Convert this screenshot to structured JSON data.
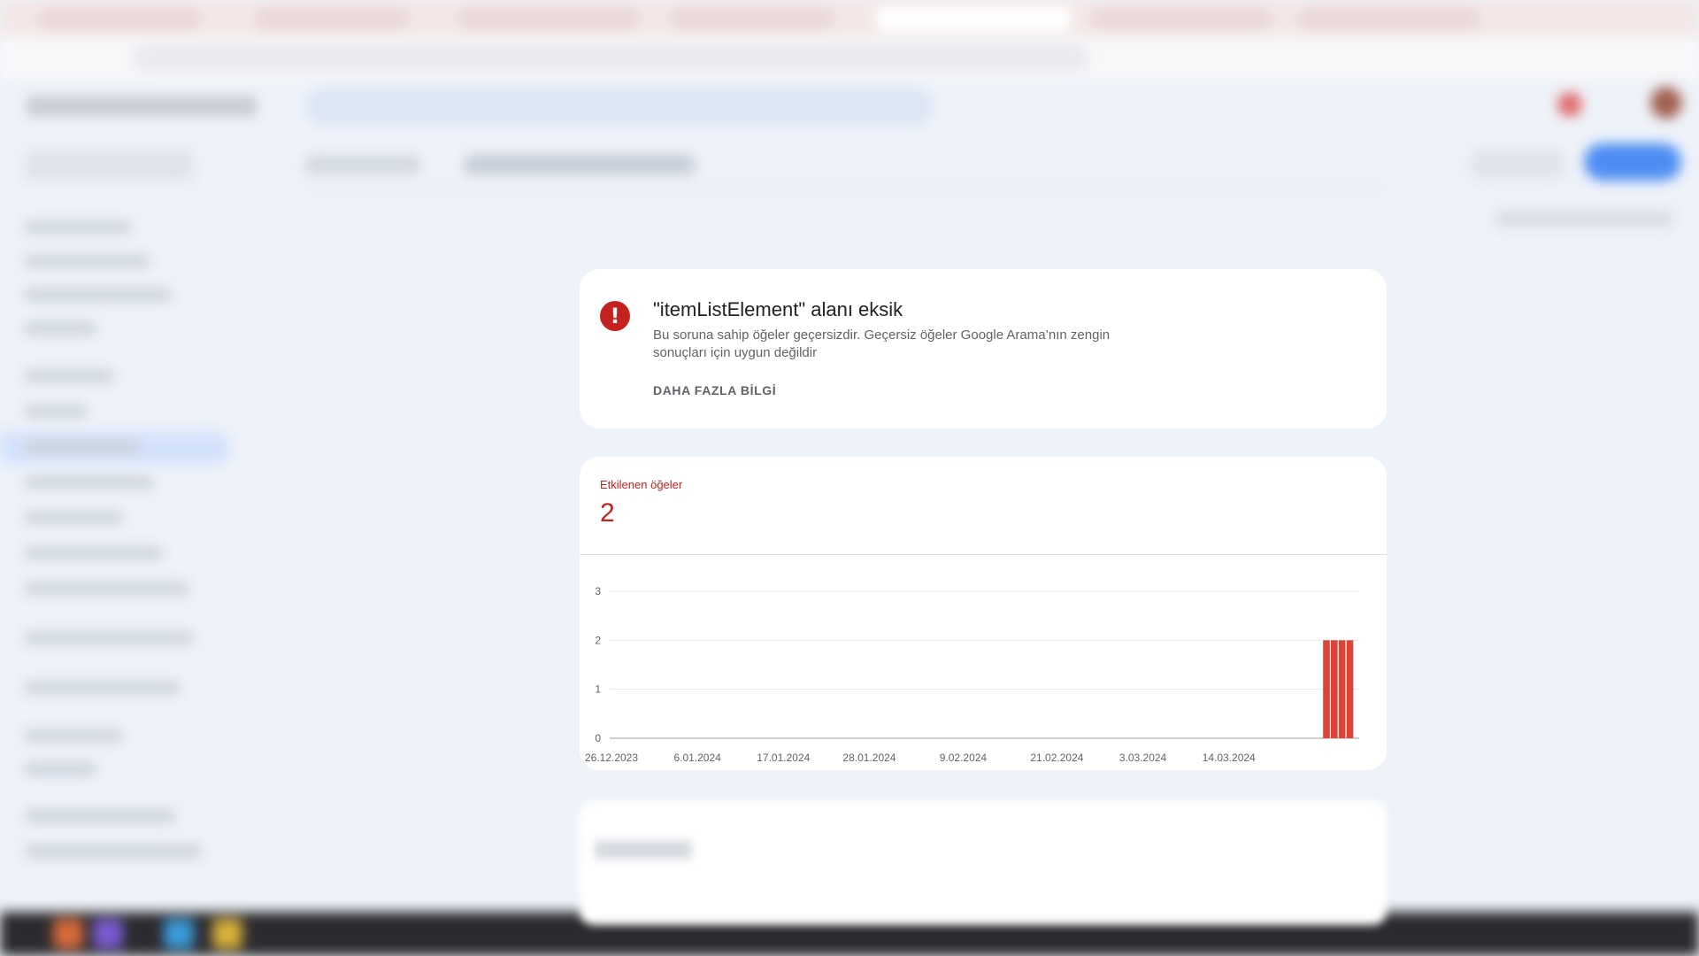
{
  "issue": {
    "title": "\"itemListElement\" alanı eksik",
    "description": "Bu soruna sahip öğeler geçersizdir. Geçersiz öğeler Google Arama’nın zengin sonuçları için uygun değildir",
    "learn_more": "DAHA FAZLA BİLGİ",
    "icon": "error-icon",
    "color": "#c5221f"
  },
  "affected": {
    "label": "Etkilenen öğeler",
    "value": "2",
    "color": "#c5221f"
  },
  "chart_data": {
    "type": "bar",
    "title": "",
    "xlabel": "",
    "ylabel": "",
    "ylim": [
      0,
      3
    ],
    "yticks": [
      0,
      1,
      2,
      3
    ],
    "x_tick_labels": [
      "26.12.2023",
      "6.01.2024",
      "17.01.2024",
      "28.01.2024",
      "9.02.2024",
      "21.02.2024",
      "3.03.2024",
      "14.03.2024"
    ],
    "x_start": "2023-12-26",
    "x_end": "2024-03-30",
    "x": [
      "2024-03-26",
      "2024-03-27",
      "2024-03-28",
      "2024-03-29"
    ],
    "values": [
      2,
      2,
      2,
      2
    ],
    "bar_color": "#db4437",
    "grid": true,
    "legend": "none"
  }
}
